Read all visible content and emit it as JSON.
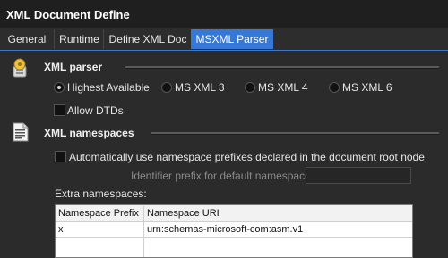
{
  "window": {
    "title": "XML Document Define"
  },
  "tabs": [
    {
      "label": "General"
    },
    {
      "label": "Runtime"
    },
    {
      "label": "Define XML Doc"
    },
    {
      "label": "MSXML Parser",
      "active": true
    }
  ],
  "parser_section": {
    "title": "XML parser",
    "icon": "gear-icon",
    "options": [
      {
        "label": "Highest Available",
        "checked": true
      },
      {
        "label": "MS XML 3",
        "checked": false
      },
      {
        "label": "MS XML 4",
        "checked": false
      },
      {
        "label": "MS XML 6",
        "checked": false
      }
    ],
    "allow_dtds": {
      "label": "Allow DTDs",
      "checked": false
    }
  },
  "namespaces_section": {
    "title": "XML namespaces",
    "icon": "document-icon",
    "auto_prefix": {
      "label": "Automatically use namespace prefixes declared in the document root node",
      "checked": false
    },
    "identifier_prefix": {
      "label": "Identifier prefix for default namespace:",
      "value": ""
    },
    "extra_label": "Extra namespaces:",
    "table": {
      "columns": [
        "Namespace Prefix",
        "Namespace URI"
      ],
      "rows": [
        [
          "x",
          "urn:schemas-microsoft-com:asm.v1"
        ]
      ]
    }
  }
}
